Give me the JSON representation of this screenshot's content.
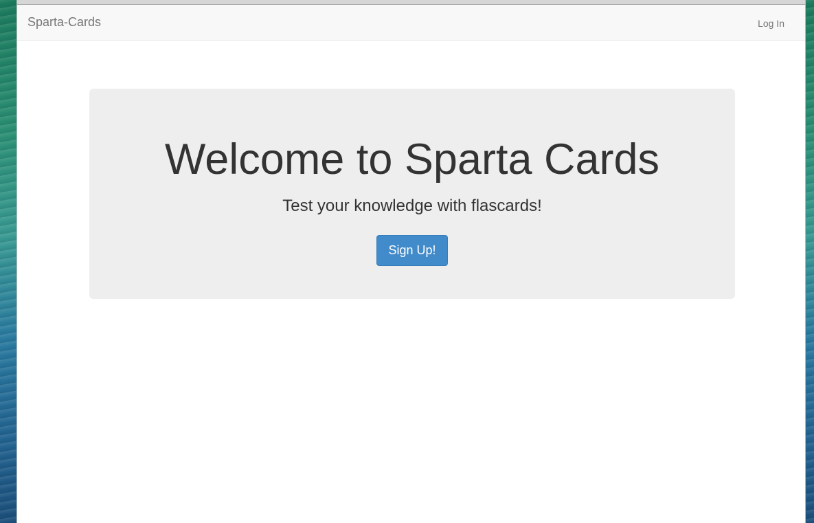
{
  "navbar": {
    "brand": "Sparta-Cards",
    "login_label": "Log In"
  },
  "jumbotron": {
    "title": "Welcome to Sparta Cards",
    "subtitle": "Test your knowledge with flascards!",
    "signup_label": "Sign Up!"
  },
  "colors": {
    "navbar_bg": "#f8f8f8",
    "jumbotron_bg": "#eeeeee",
    "primary_button": "#428bca",
    "text_dark": "#333333",
    "text_muted": "#777777"
  }
}
